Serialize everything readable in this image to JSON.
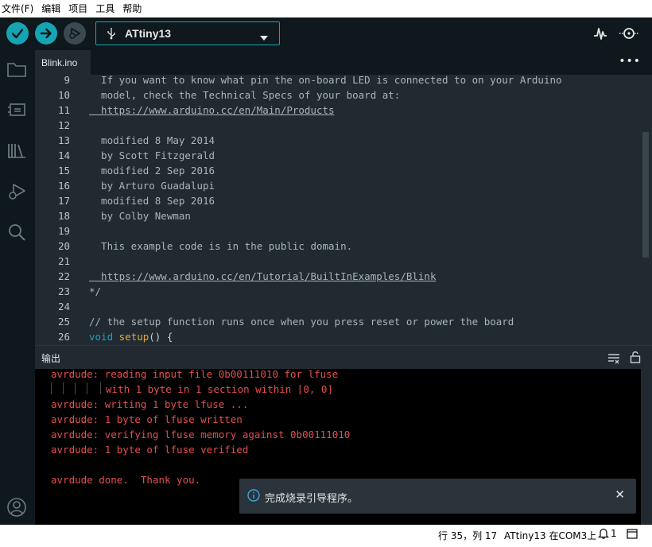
{
  "menubar": {
    "items": [
      "文件(F)",
      "编辑",
      "项目",
      "工具",
      "帮助"
    ]
  },
  "toolbar": {
    "board": "ATtiny13"
  },
  "tabs": {
    "active": "Blink.ino",
    "more": "•••"
  },
  "editor": {
    "line_numbers": [
      "9",
      "10",
      "11",
      "12",
      "13",
      "14",
      "15",
      "16",
      "17",
      "18",
      "19",
      "20",
      "21",
      "22",
      "23",
      "24",
      "25",
      "26"
    ],
    "lines": [
      "  If you want to know what pin the on-board LED is connected to on your Arduino",
      "  model, check the Technical Specs of your board at:",
      "  https://www.arduino.cc/en/Main/Products",
      "",
      "  modified 8 May 2014",
      "  by Scott Fitzgerald",
      "  modified 2 Sep 2016",
      "  by Arturo Guadalupi",
      "  modified 8 Sep 2016",
      "  by Colby Newman",
      "",
      "  This example code is in the public domain.",
      "",
      "  https://www.arduino.cc/en/Tutorial/BuiltInExamples/Blink",
      "*/",
      "",
      "// the setup function runs once when you press reset or power the board",
      ""
    ],
    "line26": {
      "keyword": "void",
      "function": "setup",
      "rest": "() {"
    }
  },
  "output": {
    "title": "输出",
    "lines": [
      "avrdude: reading input file 0b00111010 for lfuse",
      "with 1 byte in 1 section within [0, 0]",
      "avrdude: writing 1 byte lfuse ...",
      "avrdude: 1 byte of lfuse written",
      "avrdude: verifying lfuse memory against 0b00111010",
      "avrdude: 1 byte of lfuse verified",
      "",
      "avrdude done.  Thank you."
    ]
  },
  "notification": {
    "message": "完成烧录引导程序。",
    "close": "✕"
  },
  "statusbar": {
    "position": "行 35，列 17",
    "board_port": "ATtiny13 在COM3上",
    "notification_count": "1"
  },
  "colors": {
    "accent": "#16a4b3",
    "dark_bg": "#0f181d",
    "editor_bg": "#202a30",
    "output_error": "#e34f4f",
    "keyword": "#1e9fbf",
    "function": "#e8a93a"
  }
}
